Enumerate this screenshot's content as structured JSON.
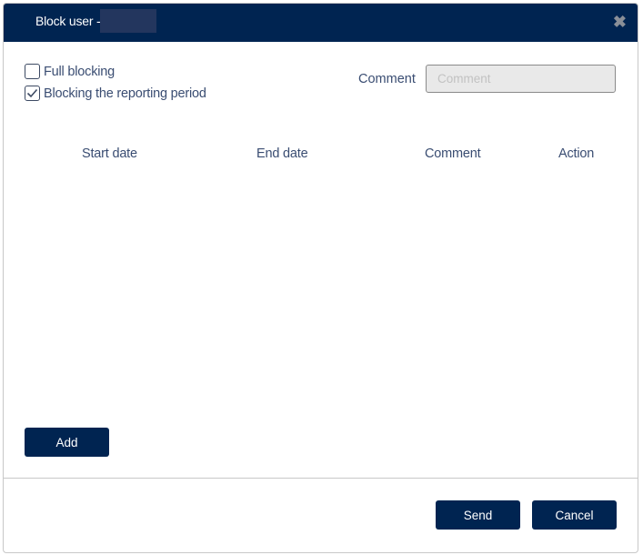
{
  "dialog": {
    "title": "Block user -",
    "close_icon": "close-x-icon"
  },
  "options": {
    "full_blocking": {
      "label": "Full blocking",
      "checked": false
    },
    "reporting_period": {
      "label": "Blocking the reporting period",
      "checked": true
    }
  },
  "comment": {
    "label": "Comment",
    "placeholder": "Comment",
    "value": ""
  },
  "table": {
    "columns": [
      "Start date",
      "End date",
      "Comment",
      "Action"
    ],
    "rows": []
  },
  "buttons": {
    "add": "Add",
    "send": "Send",
    "cancel": "Cancel"
  },
  "colors": {
    "primary": "#002451",
    "text": "#3a4d72"
  }
}
